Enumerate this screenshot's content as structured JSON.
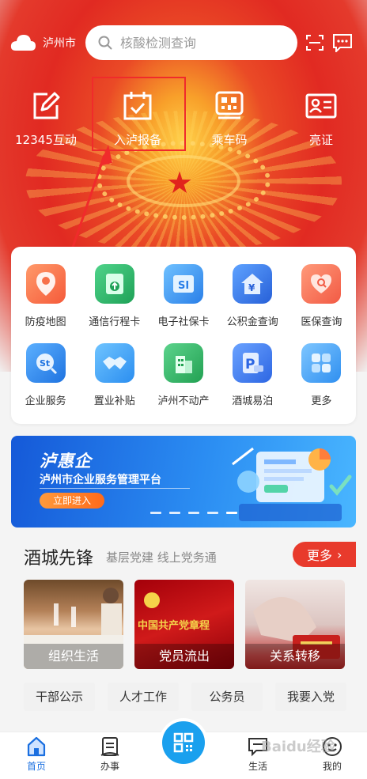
{
  "header": {
    "city": "泸州市",
    "search_placeholder": "核酸检测查询",
    "icons": [
      "cloud-icon",
      "search-icon",
      "scan-icon",
      "message-icon"
    ]
  },
  "quick_actions": [
    {
      "label": "12345互动",
      "icon": "edit-icon"
    },
    {
      "label": "入泸报备",
      "icon": "calendar-check-icon"
    },
    {
      "label": "乘车码",
      "icon": "qr-code-icon"
    },
    {
      "label": "亮证",
      "icon": "id-card-icon"
    }
  ],
  "services": [
    {
      "label": "防疫地图",
      "icon": "map-pin-icon",
      "color": "#f8613f"
    },
    {
      "label": "通信行程卡",
      "icon": "travel-card-icon",
      "color": "#27b463"
    },
    {
      "label": "电子社保卡",
      "icon": "social-security-icon",
      "color": "#2f8bea"
    },
    {
      "label": "公积金查询",
      "icon": "housing-fund-icon",
      "color": "#3275e6"
    },
    {
      "label": "医保查询",
      "icon": "medical-insurance-icon",
      "color": "#f56a4d"
    },
    {
      "label": "企业服务",
      "icon": "enterprise-icon",
      "color": "#2d8ff0"
    },
    {
      "label": "置业补贴",
      "icon": "handshake-icon",
      "color": "#3a9cf5"
    },
    {
      "label": "泸州不动产",
      "icon": "building-icon",
      "color": "#2fb45c"
    },
    {
      "label": "酒城易泊",
      "icon": "parking-icon",
      "color": "#3c79ee"
    },
    {
      "label": "更多",
      "icon": "more-grid-icon",
      "color": "#3d9cf4"
    }
  ],
  "banner": {
    "title": "泸惠企",
    "subtitle": "泸州市企业服务管理平台",
    "button": "立即进入",
    "slides": 5,
    "active_slide": 4
  },
  "section": {
    "title": "酒城先锋",
    "subtitle": "基层党建 线上党务通",
    "more": "更多",
    "photos": [
      {
        "caption": "组织生活"
      },
      {
        "caption": "党员流出"
      },
      {
        "caption": "关系转移"
      }
    ],
    "photo2_text": "中国共产党章程",
    "tags": [
      "干部公示",
      "人才工作",
      "公务员",
      "我要入党"
    ]
  },
  "bottom_nav": [
    {
      "label": "首页",
      "icon": "home-icon",
      "active": true
    },
    {
      "label": "办事",
      "icon": "service-icon",
      "active": false
    },
    {
      "label": "",
      "icon": "qr-scan-icon",
      "active": false
    },
    {
      "label": "生活",
      "icon": "chat-icon",
      "active": false
    },
    {
      "label": "我的",
      "icon": "profile-icon",
      "active": false
    }
  ],
  "watermark": "Baidu经验",
  "colors": {
    "brand_red": "#e12a22",
    "accent_blue": "#1a6fe0",
    "highlight": "#f02b2b"
  }
}
